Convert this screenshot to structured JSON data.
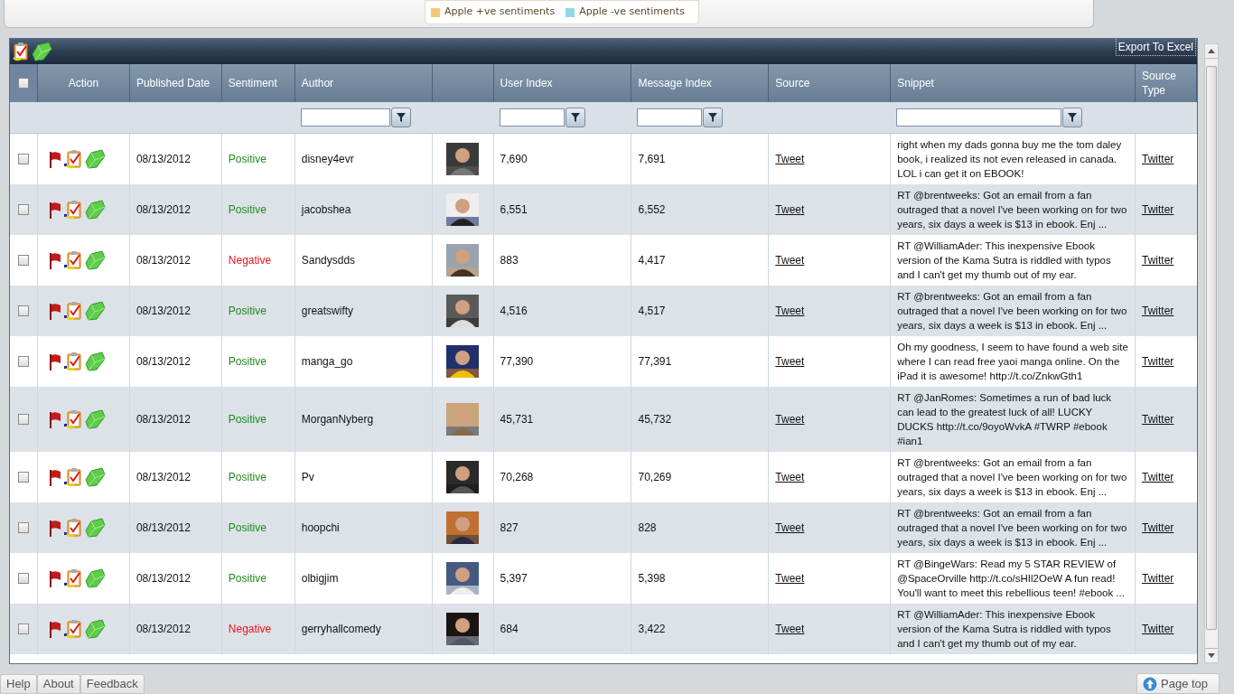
{
  "legend": [
    {
      "label": "Apple +ve sentiments",
      "color": "#f5c97a"
    },
    {
      "label": "Apple -ve sentiments",
      "color": "#94d8e6"
    }
  ],
  "toolbar": {
    "export_button": "Export To Excel"
  },
  "table": {
    "select_all_checked": false,
    "columns": [
      {
        "label": "Action",
        "filter": false
      },
      {
        "label": "Published Date",
        "filter": false
      },
      {
        "label": "Sentiment",
        "filter": false
      },
      {
        "label": "Author",
        "filter": true
      },
      {
        "filter": false
      },
      {
        "label": "User Index",
        "filter": true
      },
      {
        "label": "Message Index",
        "filter": true
      },
      {
        "label": "Source",
        "filter": false
      },
      {
        "label": "Snippet",
        "filter": true
      },
      {
        "label": "Source Type",
        "filter": false
      }
    ],
    "rows": [
      {
        "checked": false,
        "date": "08/13/2012",
        "sentiment": "Positive",
        "kind": "positive",
        "author": "disney4evr",
        "user_index": "7,690",
        "message_index": "7,691",
        "source": "Tweet",
        "snippet": "right when my dads gonna buy me the tom daley book, i realized its not even released in canada. LOL i can get it on EBOOK!",
        "source_type": "Twitter"
      },
      {
        "checked": false,
        "date": "08/13/2012",
        "sentiment": "Positive",
        "kind": "positive",
        "author": "jacobshea",
        "user_index": "6,551",
        "message_index": "6,552",
        "source": "Tweet",
        "snippet": "RT @brentweeks: Got an email from a fan outraged that a novel I've been working on for two years, six days a week is $13 in ebook. Enj ...",
        "source_type": "Twitter"
      },
      {
        "checked": false,
        "date": "08/13/2012",
        "sentiment": "Negative",
        "kind": "negative",
        "author": "Sandysdds",
        "user_index": "883",
        "message_index": "4,417",
        "source": "Tweet",
        "snippet": "RT @WilliamAder: This inexpensive Ebook version of the Kama Sutra is riddled with typos and I can't get my thumb out of my ear.",
        "source_type": "Twitter"
      },
      {
        "checked": false,
        "date": "08/13/2012",
        "sentiment": "Positive",
        "kind": "positive",
        "author": "greatswifty",
        "user_index": "4,516",
        "message_index": "4,517",
        "source": "Tweet",
        "snippet": "RT @brentweeks: Got an email from a fan outraged that a novel I've been working on for two years, six days a week is $13 in ebook. Enj ...",
        "source_type": "Twitter"
      },
      {
        "checked": false,
        "date": "08/13/2012",
        "sentiment": "Positive",
        "kind": "positive",
        "author": "manga_go",
        "user_index": "77,390",
        "message_index": "77,391",
        "source": "Tweet",
        "snippet": "Oh my goodness, I seem to have found a web site where I can read free yaoi manga online. On the iPad it is awesome! http://t.co/ZnkwGth1",
        "source_type": "Twitter"
      },
      {
        "checked": false,
        "date": "08/13/2012",
        "sentiment": "Positive",
        "kind": "positive",
        "author": "MorganNyberg",
        "user_index": "45,731",
        "message_index": "45,732",
        "source": "Tweet",
        "snippet": "RT @JanRomes: Sometimes a run of bad luck can lead to the greatest luck of all! LUCKY DUCKS http://t.co/9oyoWvkA #TWRP #ebook #ian1",
        "source_type": "Twitter"
      },
      {
        "checked": false,
        "date": "08/13/2012",
        "sentiment": "Positive",
        "kind": "positive",
        "author": "Pv",
        "user_index": "70,268",
        "message_index": "70,269",
        "source": "Tweet",
        "snippet": "RT @brentweeks: Got an email from a fan outraged that a novel I've been working on for two years, six days a week is $13 in ebook. Enj ...",
        "source_type": "Twitter"
      },
      {
        "checked": false,
        "date": "08/13/2012",
        "sentiment": "Positive",
        "kind": "positive",
        "author": "hoopchi",
        "user_index": "827",
        "message_index": "828",
        "source": "Tweet",
        "snippet": "RT @brentweeks: Got an email from a fan outraged that a novel I've been working on for two years, six days a week is $13 in ebook. Enj ...",
        "source_type": "Twitter"
      },
      {
        "checked": false,
        "date": "08/13/2012",
        "sentiment": "Positive",
        "kind": "positive",
        "author": "olbigjim",
        "user_index": "5,397",
        "message_index": "5,398",
        "source": "Tweet",
        "snippet": "RT @BingeWars: Read my 5 STAR REVIEW of @SpaceOrville http://t.co/sHIl2OeW A fun read! You'll want to meet this rebellious teen! #ebook ...",
        "source_type": "Twitter"
      },
      {
        "checked": false,
        "date": "08/13/2012",
        "sentiment": "Negative",
        "kind": "negative",
        "author": "gerryhallcomedy",
        "user_index": "684",
        "message_index": "3,422",
        "source": "Tweet",
        "snippet": "RT @WilliamAder: This inexpensive Ebook version of the Kama Sutra is riddled with typos and I can't get my thumb out of my ear.",
        "source_type": "Twitter"
      }
    ]
  },
  "footer_tabs": [
    "Help",
    "About",
    "Feedback"
  ],
  "page_top_button": "Page top"
}
